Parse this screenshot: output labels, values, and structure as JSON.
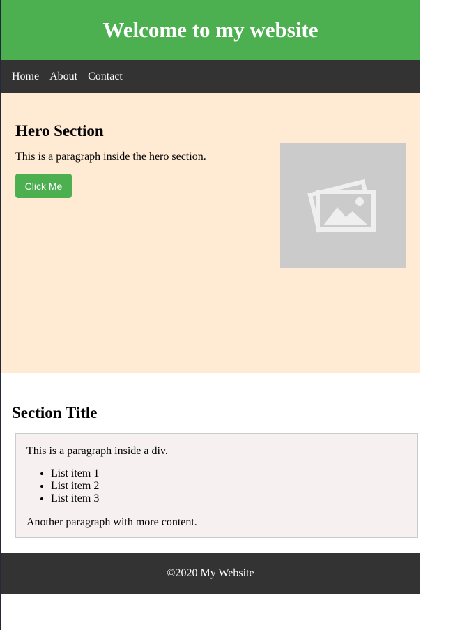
{
  "header": {
    "title": "Welcome to my website",
    "background": "#4caf50"
  },
  "nav": {
    "items": [
      {
        "label": "Home"
      },
      {
        "label": "About"
      },
      {
        "label": "Contact"
      }
    ],
    "background": "#333333"
  },
  "hero": {
    "title": "Hero Section",
    "text": "This is a paragraph inside the hero section.",
    "button_label": "Click Me",
    "image_icon": "image-placeholder-icon",
    "background": "#ffebd3"
  },
  "content": {
    "title": "Section Title",
    "paragraph1": "This is a paragraph inside a div.",
    "list": [
      "List item 1",
      "List item 2",
      "List item 3"
    ],
    "paragraph2": "Another paragraph with more content."
  },
  "footer": {
    "text": "©2020 My Website"
  }
}
